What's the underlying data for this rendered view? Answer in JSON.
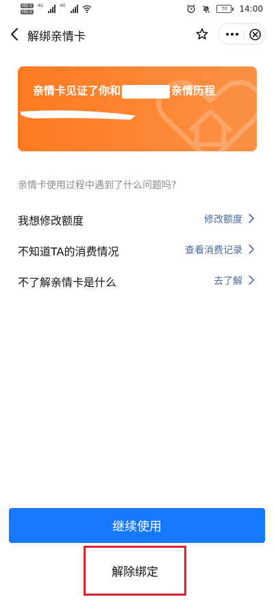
{
  "status_bar": {
    "sim1_badge": "HD 1",
    "sim2_badge": "HD 2",
    "network_type": "4G",
    "battery_level": "70",
    "time": "14:00",
    "icons": [
      "signal-icon",
      "wifi-icon",
      "alarm-icon",
      "mute-icon",
      "battery-icon"
    ]
  },
  "nav": {
    "title": "解绑亲情卡",
    "icons": [
      "back-arrow-icon",
      "star-icon",
      "more-dots-icon",
      "close-circle-icon"
    ]
  },
  "card": {
    "title_prefix": "亲情卡见证了你和",
    "title_suffix": "亲情历程",
    "gradient": [
      "#ff7a1f",
      "#fb9146"
    ],
    "decoration_icon": "heart-house-icon"
  },
  "question": "亲情卡使用过程中遇到了什么问题吗?",
  "rows": [
    {
      "label": "我想修改额度",
      "action": "修改额度"
    },
    {
      "label": "不知道TA的消费情况",
      "action": "查看消费记录"
    },
    {
      "label": "不了解亲情卡是什么",
      "action": "去了解"
    }
  ],
  "buttons": {
    "continue_label": "继续使用",
    "unbind_label": "解除绑定"
  },
  "colors": {
    "primary": "#1677ff",
    "link": "#4a6a9a",
    "highlight_border": "#d9232b"
  }
}
